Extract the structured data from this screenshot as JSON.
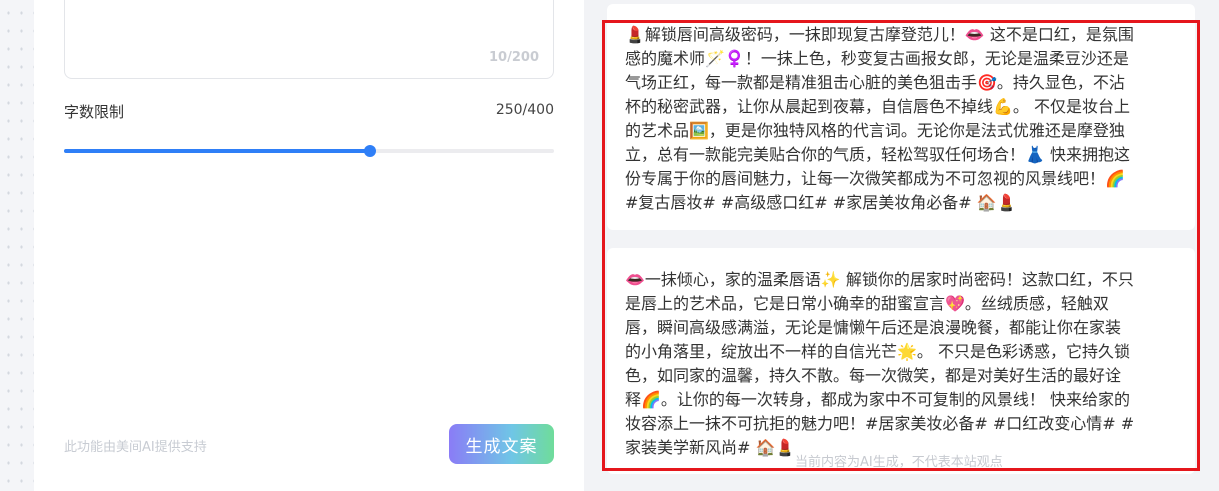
{
  "input": {
    "char_count": "10/200"
  },
  "word_limit": {
    "label": "字数限制",
    "value_text": "250/400",
    "value": 250,
    "max": 400,
    "accent_color": "#2f7ff7"
  },
  "footer": {
    "ai_note": "此功能由美间AI提供支持",
    "generate_label": "生成文案"
  },
  "results": [
    {
      "text": "💄解锁唇间高级密码，一抹即现复古摩登范儿！👄 这不是口红，是氛围\n感的魔术师🪄♀️！一抹上色，秒变复古画报女郎，无论是温柔豆沙还是\n气场正红，每一款都是精准狙击心脏的美色狙击手🎯。持久显色，不沾\n杯的秘密武器，让你从晨起到夜幕，自信唇色不掉线💪。 不仅是妆台上\n的艺术品🖼️，更是你独特风格的代言词。无论你是法式优雅还是摩登独\n立，总有一款能完美贴合你的气质，轻松驾驭任何场合！👗 快来拥抱这\n份专属于你的唇间魅力，让每一次微笑都成为不可忽视的风景线吧！🌈\n#复古唇妆# #高级感口红# #家居美妆角必备# 🏠💄"
    },
    {
      "text": "👄一抹倾心，家的温柔唇语✨ 解锁你的居家时尚密码！这款口红，不只\n是唇上的艺术品，它是日常小确幸的甜蜜宣言💖。丝绒质感，轻触双\n唇，瞬间高级感满溢，无论是慵懒午后还是浪漫晚餐，都能让你在家装\n的小角落里，绽放出不一样的自信光芒🌟。 不只是色彩诱惑，它持久锁\n色，如同家的温馨，持久不散。每一次微笑，都是对美好生活的最好诠\n释🌈。让你的每一次转身，都成为家中不可复制的风景线！ 快来给家的\n妆容添上一抹不可抗拒的魅力吧！#居家美妆必备# #口红改变心情# #\n家装美学新风尚# 🏠💄"
    }
  ],
  "watermark": "当前内容为AI生成，不代表本站观点",
  "highlight_color": "#e5161c"
}
